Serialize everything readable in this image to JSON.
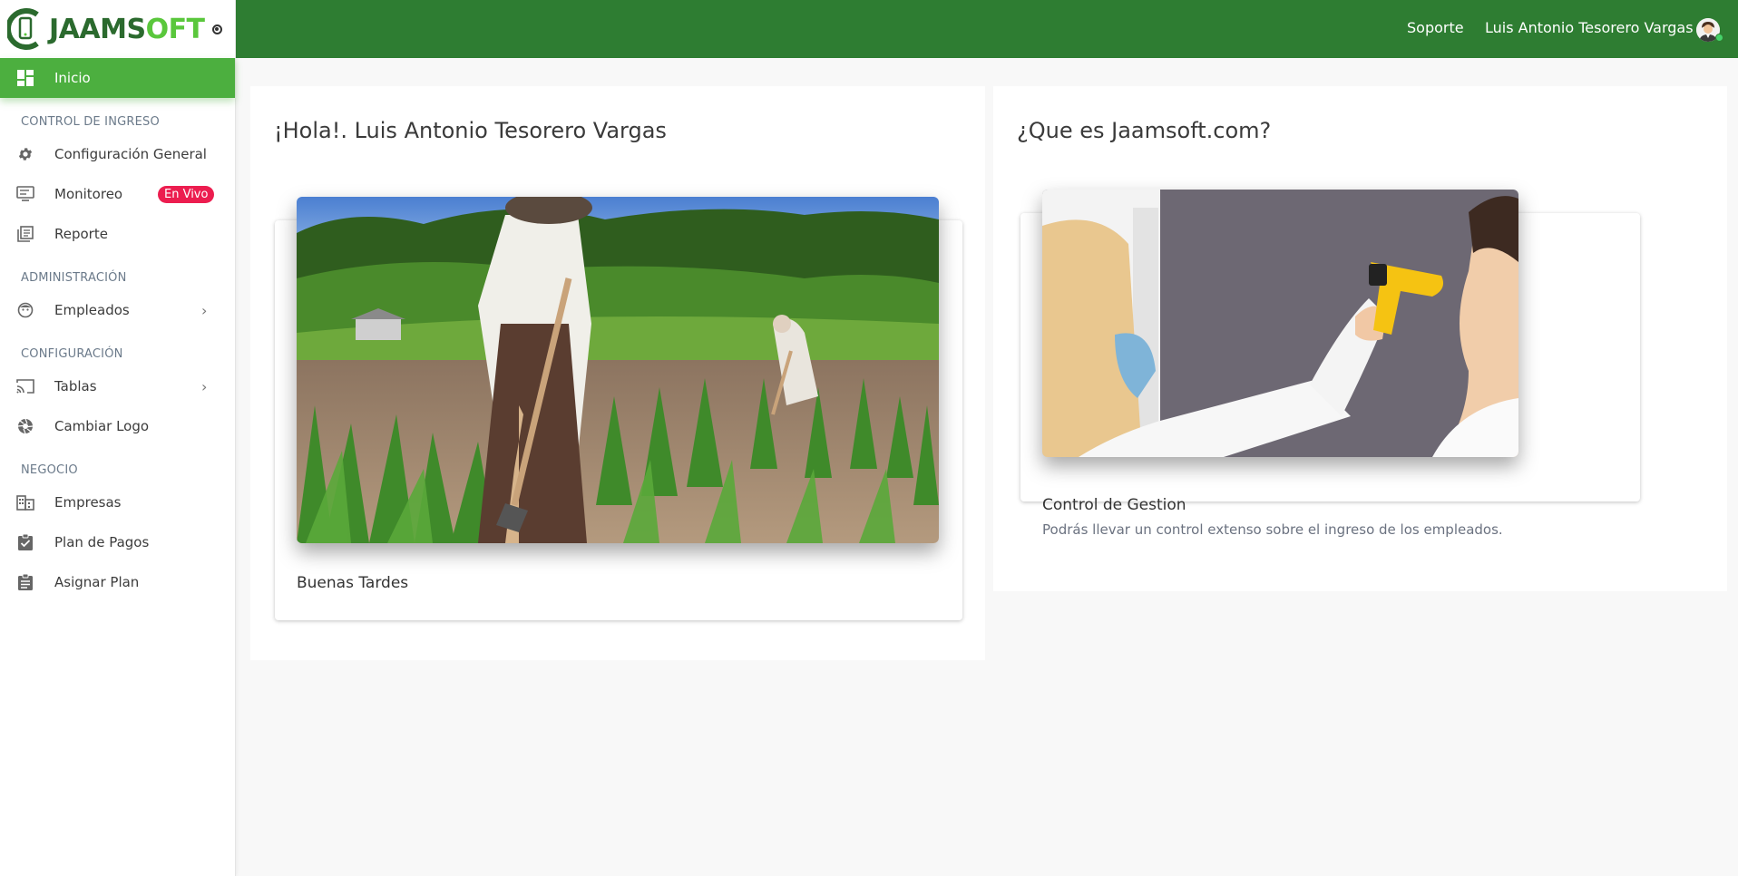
{
  "brand": {
    "part1": "JAAMS",
    "part2": "OFT"
  },
  "header": {
    "support_label": "Soporte",
    "user_name": "Luis Antonio Tesorero Vargas"
  },
  "sidebar": {
    "home": "Inicio",
    "sections": [
      {
        "title": "CONTROL DE INGRESO"
      },
      {
        "title": "ADMINISTRACIÓN"
      },
      {
        "title": "CONFIGURACIÓN"
      },
      {
        "title": "NEGOCIO"
      }
    ],
    "items": {
      "config_general": "Configuración General",
      "monitoreo": "Monitoreo",
      "monitoreo_badge": "En Vivo",
      "reporte": "Reporte",
      "empleados": "Empleados",
      "tablas": "Tablas",
      "cambiar_logo": "Cambiar Logo",
      "empresas": "Empresas",
      "plan_pagos": "Plan de Pagos",
      "asignar_plan": "Asignar Plan"
    }
  },
  "main": {
    "greeting_panel": {
      "title": "¡Hola!. Luis Antonio Tesorero Vargas",
      "card_title": "Buenas Tardes"
    },
    "about_panel": {
      "title": "¿Que es Jaamsoft.com?",
      "card_title": "Control de Gestion",
      "card_text": "Podrás llevar un control extenso sobre el ingreso de los empleados."
    }
  },
  "colors": {
    "header": "#2e7d32",
    "active": "#4caf3f",
    "badge": "#ec1d4f"
  }
}
